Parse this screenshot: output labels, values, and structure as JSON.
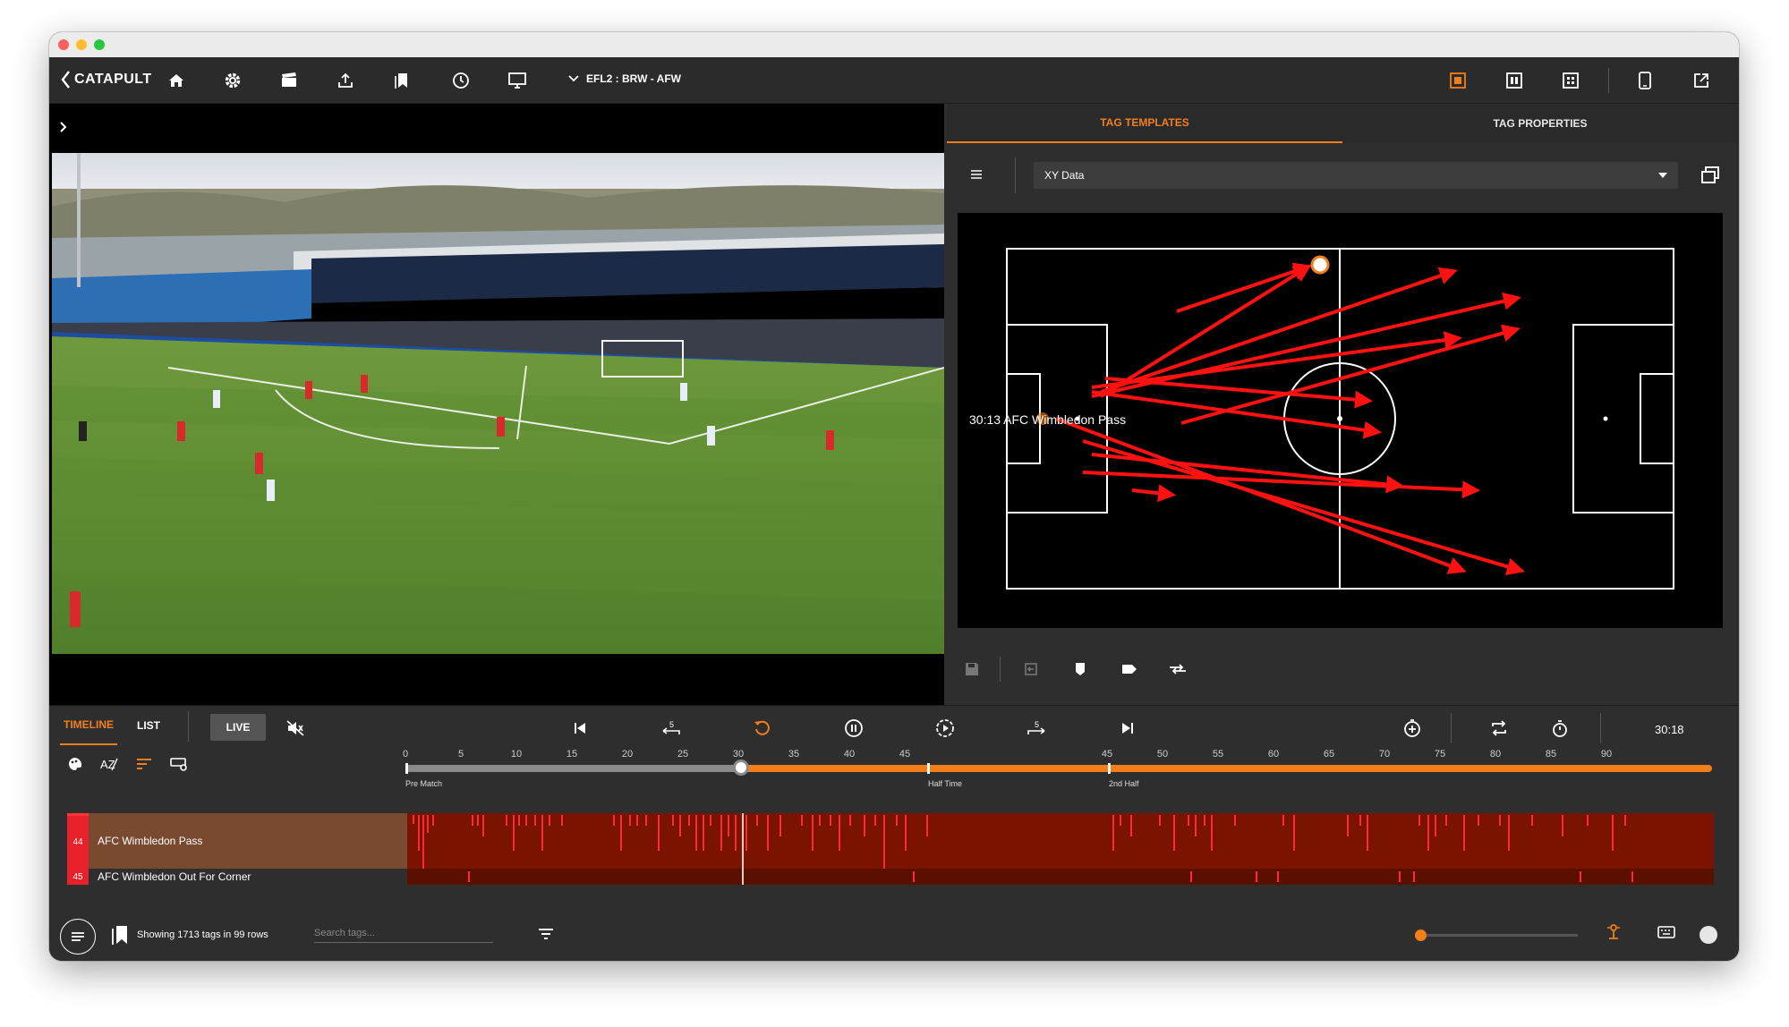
{
  "app": {
    "logo": "CATAPULT",
    "match": "EFL2 : BRW - AFW",
    "accent": "#f27f1b"
  },
  "toolbar": {
    "left_icons": [
      "home-icon",
      "gear-icon",
      "clapperboard-icon",
      "upload-icon",
      "bookmarks-icon",
      "clock-icon",
      "monitor-icon"
    ],
    "right_icons": [
      "single-layout-icon",
      "split-layout-icon",
      "grid-layout-icon",
      "tablet-icon",
      "external-link-icon"
    ]
  },
  "panel": {
    "tabs": [
      {
        "label": "TAG TEMPLATES",
        "active": true
      },
      {
        "label": "TAG PROPERTIES",
        "active": false
      }
    ],
    "template_select": "XY Data",
    "pitch_label": "30:13 AFC Wimbledon Pass"
  },
  "bottom": {
    "tabs": [
      {
        "label": "TIMELINE",
        "active": true
      },
      {
        "label": "LIST",
        "active": false
      }
    ],
    "live": "LIVE",
    "time": "30:18",
    "ticks_first": [
      "0",
      "5",
      "10",
      "15",
      "20",
      "25",
      "30",
      "35",
      "40",
      "45"
    ],
    "ticks_second": [
      "45",
      "50",
      "55",
      "60",
      "65",
      "70",
      "75",
      "80",
      "85",
      "90"
    ],
    "segments": {
      "pre_match": "Pre Match",
      "half_time": "Half Time",
      "second_half": "2nd Half"
    },
    "rows": [
      {
        "number": "44",
        "label": "AFC Wimbledon Pass"
      },
      {
        "number": "45",
        "label": "AFC Wimbledon Out For Corner"
      }
    ],
    "status": "Showing 1713 tags in 99 rows",
    "search_placeholder": "Search tags..."
  }
}
